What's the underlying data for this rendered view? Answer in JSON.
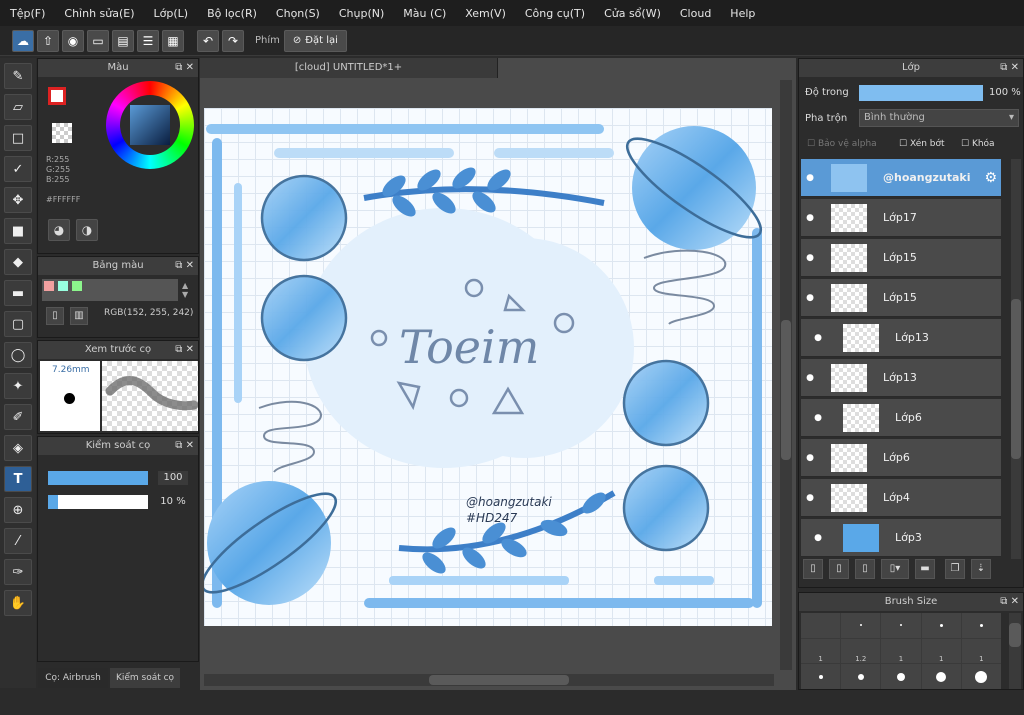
{
  "menu": [
    "Tệp(F)",
    "Chỉnh sửa(E)",
    "Lớp(L)",
    "Bộ lọc(R)",
    "Chọn(S)",
    "Chụp(N)",
    "Màu (C)",
    "Xem(V)",
    "Công cụ(T)",
    "Cửa sổ(W)",
    "Cloud",
    "Help"
  ],
  "toolbar": {
    "label": "Phím",
    "reset": "Đặt lại"
  },
  "color_panel": {
    "title": "Màu",
    "r": "R:255",
    "g": "G:255",
    "b": "B:255",
    "hex": "#FFFFFF"
  },
  "palette_panel": {
    "title": "Bảng màu",
    "rgb": "RGB(152, 255, 242)"
  },
  "brush_preview": {
    "title": "Xem trước cọ",
    "size": "7.26mm"
  },
  "brush_control": {
    "title": "Kiểm soát cọ",
    "value1": "100",
    "value2": "10 %"
  },
  "bottom_tabs": {
    "tab1": "Cọ: Airbrush",
    "tab2": "Kiểm soát cọ"
  },
  "canvas": {
    "tab": "[cloud] UNTITLED*1+",
    "art_word": "Toeim",
    "credit1": "@hoangzutaki",
    "credit2": "#HD247"
  },
  "layers_panel": {
    "title": "Lớp",
    "opacity_label": "Độ trong",
    "opacity_value": "100 %",
    "blend_label": "Pha trộn",
    "blend_value": "Bình thường",
    "protect_alpha": "Bảo vệ alpha",
    "clip": "Xén bớt",
    "lock": "Khóa",
    "items": [
      {
        "name": "@hoangzutaki"
      },
      {
        "name": "Lớp17"
      },
      {
        "name": "Lớp15"
      },
      {
        "name": "Lớp15"
      },
      {
        "name": "Lớp13"
      },
      {
        "name": "Lớp13"
      },
      {
        "name": "Lớp6"
      },
      {
        "name": "Lớp6"
      },
      {
        "name": "Lớp4"
      },
      {
        "name": "Lớp3"
      }
    ]
  },
  "brush_size_panel": {
    "title": "Brush Size",
    "labels": [
      "1",
      "1.2",
      "1",
      "1",
      "1"
    ]
  },
  "colors": {
    "accent": "#3a6ea5",
    "selected_layer": "#5a9ad6",
    "art_blue": "#5aa8e8"
  }
}
